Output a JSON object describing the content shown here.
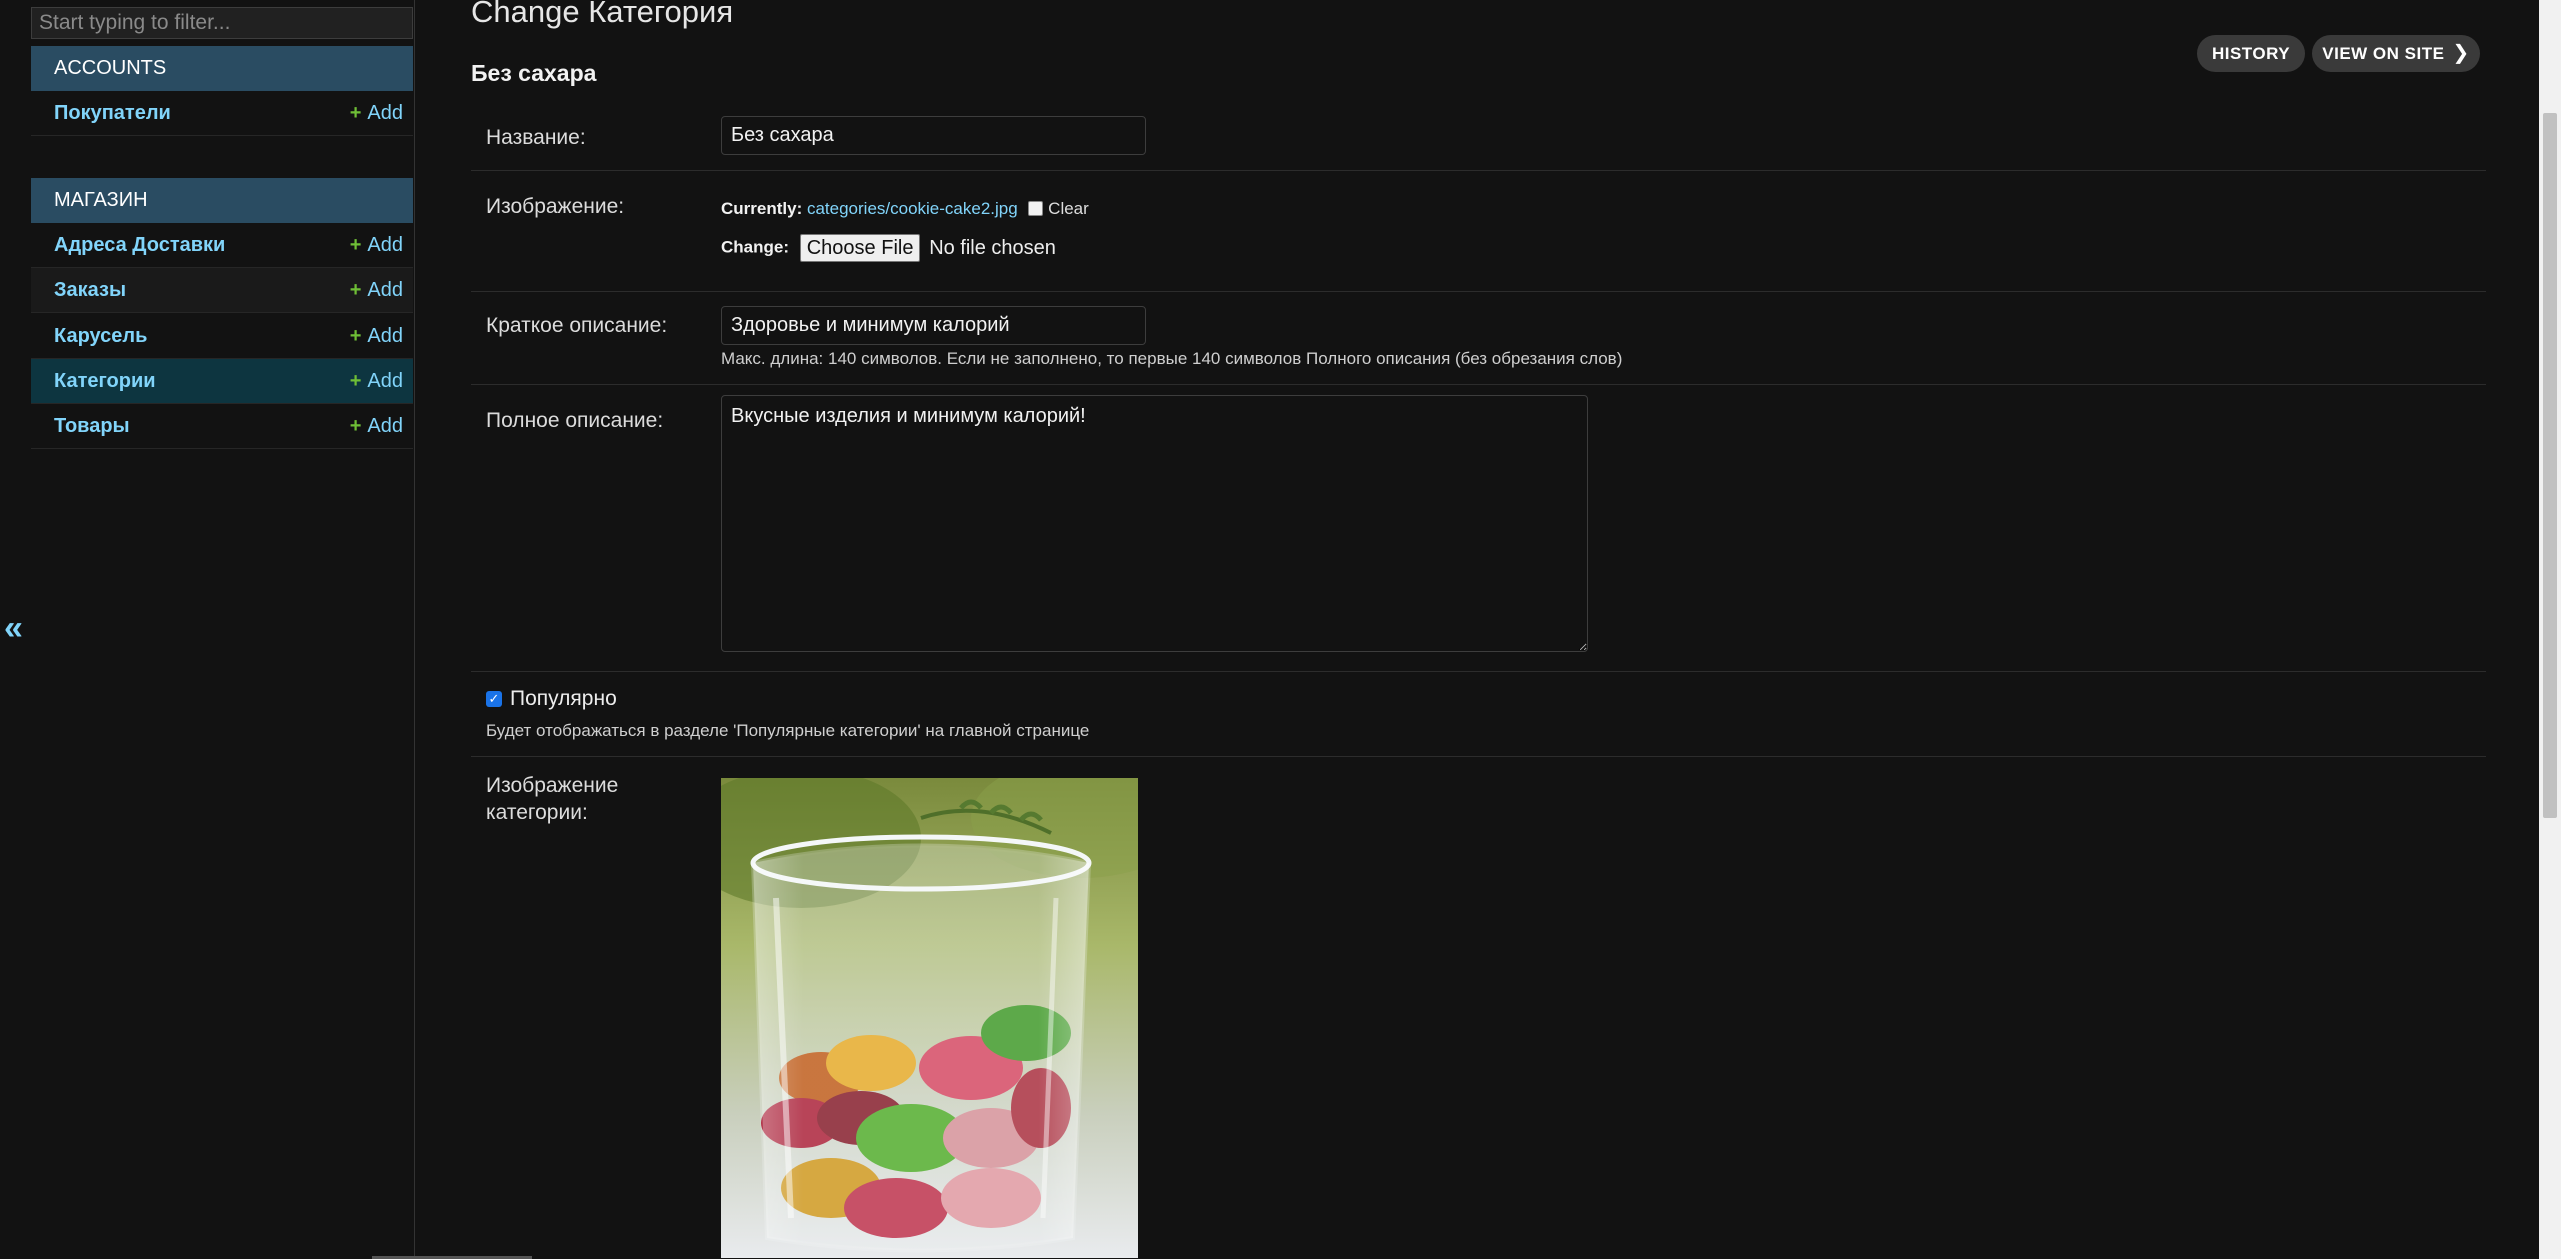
{
  "sidebar": {
    "filter_placeholder": "Start typing to filter...",
    "collapse_glyph": "«",
    "modules": [
      {
        "caption": "ACCOUNTS",
        "models": [
          {
            "label": "Покупатели",
            "add": "Add"
          }
        ]
      },
      {
        "caption": "МАГАЗИН",
        "models": [
          {
            "label": "Адреса Доставки",
            "add": "Add"
          },
          {
            "label": "Заказы",
            "add": "Add"
          },
          {
            "label": "Карусель",
            "add": "Add"
          },
          {
            "label": "Категории",
            "add": "Add",
            "current": true
          },
          {
            "label": "Товары",
            "add": "Add"
          }
        ]
      }
    ]
  },
  "header": {
    "title": "Change Категория",
    "object_name": "Без сахара",
    "tools": {
      "history": "HISTORY",
      "view_on_site": "VIEW ON SITE"
    }
  },
  "form": {
    "name": {
      "label": "Название:",
      "value": "Без сахара"
    },
    "image": {
      "label": "Изображение:",
      "currently_label": "Currently:",
      "currently_value": "categories/cookie-cake2.jpg",
      "clear_label": "Clear",
      "change_label": "Change:",
      "choose_file": "Choose File",
      "no_file": "No file chosen"
    },
    "short_description": {
      "label": "Краткое описание:",
      "value": "Здоровье и минимум калорий",
      "help": "Макс. длина: 140 символов. Если не заполнено, то первые 140 символов Полного описания (без обрезания слов)"
    },
    "full_description": {
      "label": "Полное описание:",
      "value": "Вкусные изделия и минимум калорий!"
    },
    "popular": {
      "label": "Популярно",
      "checked": true,
      "help": "Будет отображаться в разделе 'Популярные категории' на главной странице"
    },
    "category_image": {
      "label": "Изображение категории:"
    }
  },
  "colors": {
    "background": "#121212",
    "link": "#81d4fa",
    "module_caption_bg": "#2a4c62",
    "add_plus": "#6fbf36",
    "current_row": "#0d3540"
  }
}
